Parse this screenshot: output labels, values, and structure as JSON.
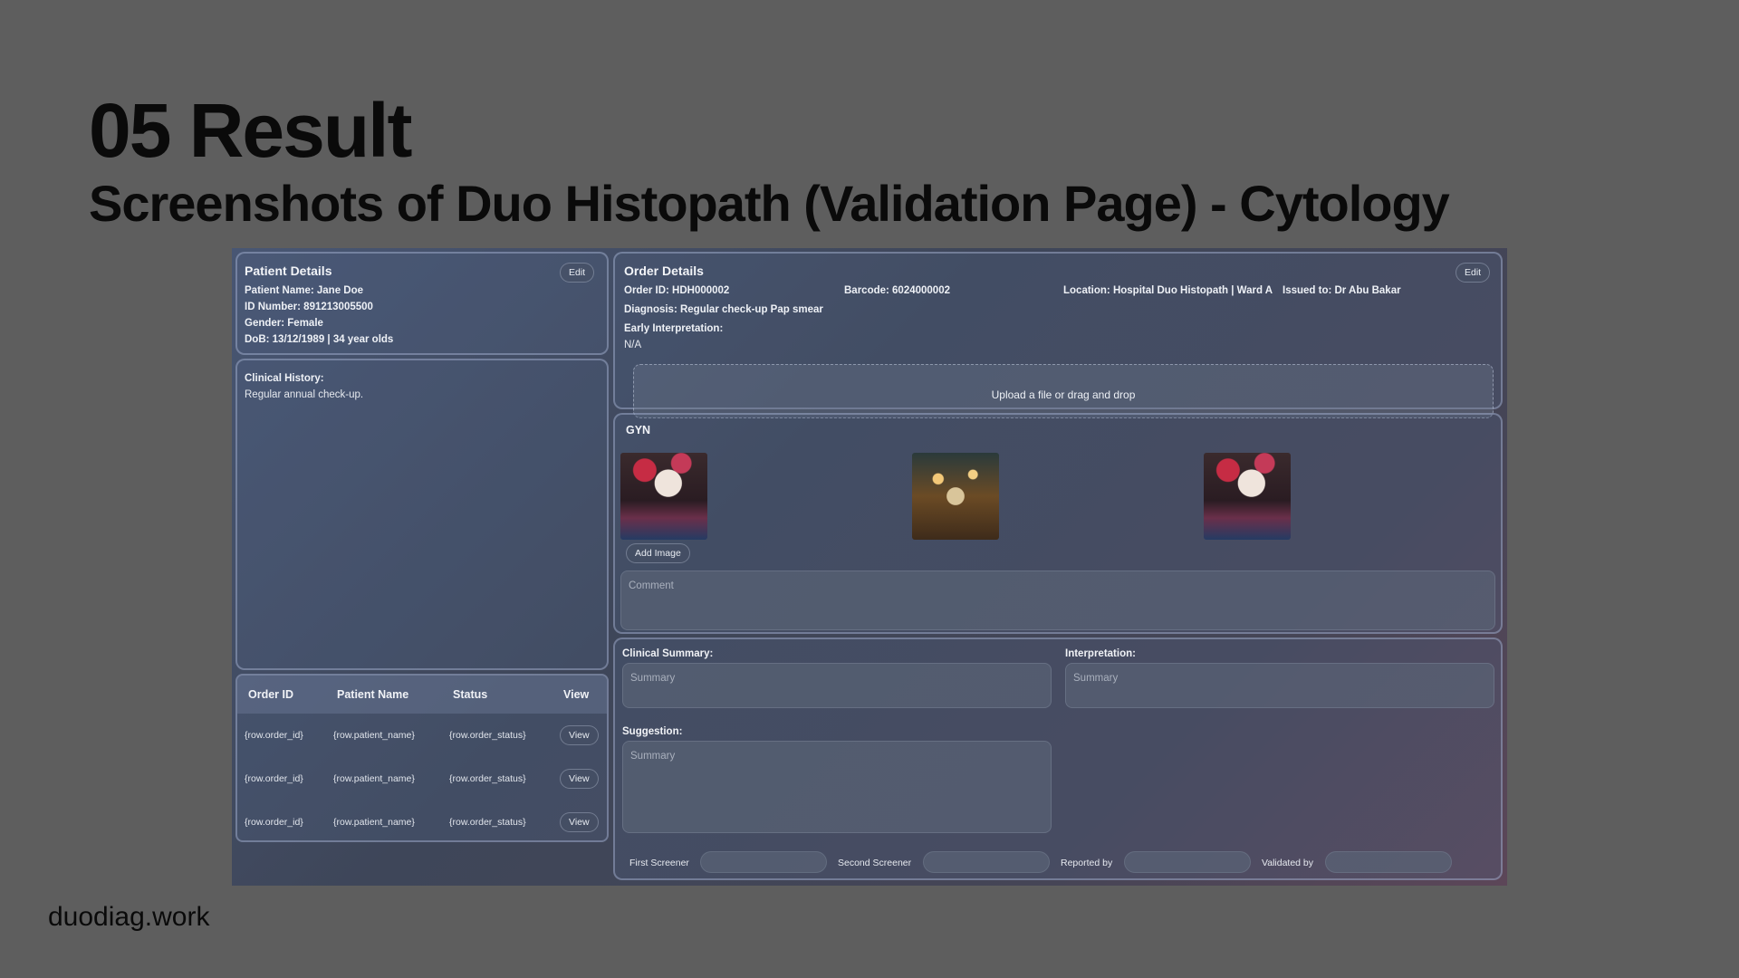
{
  "slide": {
    "title": "05 Result",
    "subtitle": "Screenshots of Duo Histopath (Validation Page) - Cytology",
    "footer": "duodiag.work"
  },
  "patient": {
    "title": "Patient Details",
    "edit_label": "Edit",
    "name": "Patient Name: Jane Doe",
    "id_number": "ID Number: 891213005500",
    "gender": "Gender: Female",
    "dob": "DoB: 13/12/1989 | 34 year olds"
  },
  "clinical_history": {
    "label": "Clinical History:",
    "text": "Regular annual check-up."
  },
  "orders_table": {
    "headers": [
      "Order ID",
      "Patient Name",
      "Status",
      "View"
    ],
    "rows": [
      {
        "order_id": "{row.order_id}",
        "patient_name": "{row.patient_name}",
        "status": "{row.order_status}",
        "view": "View"
      },
      {
        "order_id": "{row.order_id}",
        "patient_name": "{row.patient_name}",
        "status": "{row.order_status}",
        "view": "View"
      },
      {
        "order_id": "{row.order_id}",
        "patient_name": "{row.patient_name}",
        "status": "{row.order_status}",
        "view": "View"
      }
    ]
  },
  "order": {
    "title": "Order Details",
    "edit_label": "Edit",
    "order_id": "Order ID: HDH000002",
    "barcode": "Barcode: 6024000002",
    "location": "Location: Hospital Duo Histopath | Ward A",
    "issued_to": "Issued to: Dr Abu Bakar",
    "diagnosis": "Diagnosis: Regular check-up Pap smear",
    "early_interpretation_label": "Early Interpretation:",
    "early_interpretation_value": "N/A",
    "upload_text": "Upload a file or drag and drop"
  },
  "gyn": {
    "title": "GYN",
    "images": [
      "skull-face-photo",
      "cafe-lights-photo",
      "skull-face-photo"
    ],
    "add_image_label": "Add Image",
    "comment_placeholder": "Comment"
  },
  "summary": {
    "clinical_summary_label": "Clinical Summary:",
    "interpretation_label": "Interpretation:",
    "suggestion_label": "Suggestion:",
    "placeholder": "Summary"
  },
  "signoff": {
    "first_screener": "First Screener",
    "second_screener": "Second Screener",
    "reported_by": "Reported by",
    "validated_by": "Validated by"
  }
}
